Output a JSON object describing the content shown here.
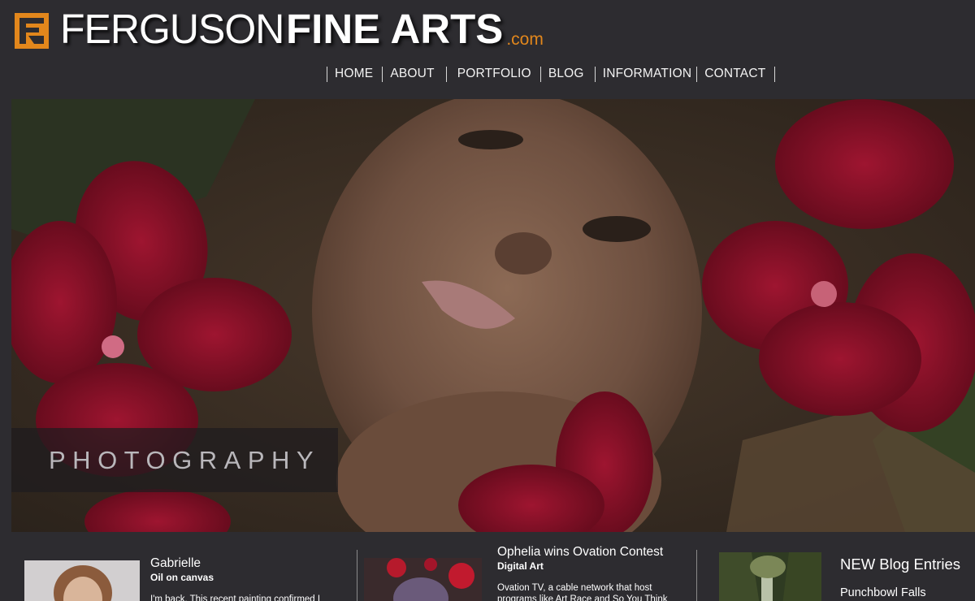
{
  "brand": {
    "name_thin": "FERGUSON",
    "name_bold": "FINE ARTS",
    "tld": ".com",
    "accent_color": "#e2871c"
  },
  "nav": {
    "items": [
      {
        "label": "HOME"
      },
      {
        "label": "ABOUT"
      },
      {
        "label": "PORTFOLIO"
      },
      {
        "label": "BLOG"
      },
      {
        "label": "INFORMATION"
      },
      {
        "label": "CONTACT"
      }
    ]
  },
  "hero": {
    "caption": "PHOTOGRAPHY"
  },
  "features": [
    {
      "title": "Gabrielle",
      "subtitle": "Oil on canvas",
      "excerpt": "I'm back. This recent painting confirmed I"
    },
    {
      "title": "Ophelia wins Ovation Contest",
      "subtitle": "Digital Art",
      "excerpt": "Ovation TV, a cable network that host programs like Art Race and So You Think"
    },
    {
      "title": "NEW Blog Entries",
      "link": "Punchbowl Falls"
    }
  ]
}
